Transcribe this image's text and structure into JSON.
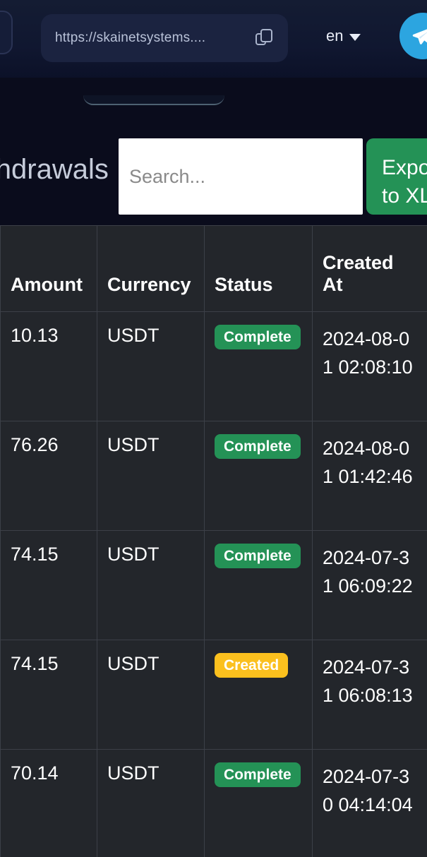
{
  "browser_header": {
    "back_button": "back-button",
    "url": "https://skainetsystems....",
    "copy_icon": "copy-icon",
    "language": "en",
    "chevron": "chevron-down-icon",
    "avatar_icon": "telegram-send-icon"
  },
  "toolbar": {
    "page_title": "Withdrawals",
    "search_placeholder": "Search...",
    "search_value": "",
    "export_label": "Export\nto XLSX"
  },
  "table": {
    "columns": [
      "Amount",
      "Currency",
      "Status",
      "Created At"
    ],
    "rows": [
      {
        "amount": "10.13",
        "currency": "USDT",
        "status": "Complete",
        "status_kind": "complete",
        "created_at": "2024-08-01 02:08:10"
      },
      {
        "amount": "76.26",
        "currency": "USDT",
        "status": "Complete",
        "status_kind": "complete",
        "created_at": "2024-08-01 01:42:46"
      },
      {
        "amount": "74.15",
        "currency": "USDT",
        "status": "Complete",
        "status_kind": "complete",
        "created_at": "2024-07-31 06:09:22"
      },
      {
        "amount": "74.15",
        "currency": "USDT",
        "status": "Created",
        "status_kind": "created",
        "created_at": "2024-07-31 06:08:13"
      },
      {
        "amount": "70.14",
        "currency": "USDT",
        "status": "Complete",
        "status_kind": "complete",
        "created_at": "2024-07-30 04:14:04"
      }
    ]
  },
  "colors": {
    "page_background": "#0a0c1c",
    "header_background": "#101730",
    "table_cell_background": "#23262b",
    "table_border": "#3c4048",
    "accent_green": "#249256",
    "accent_yellow": "#fbc01e",
    "telegram_blue": "#2ca5e0"
  }
}
